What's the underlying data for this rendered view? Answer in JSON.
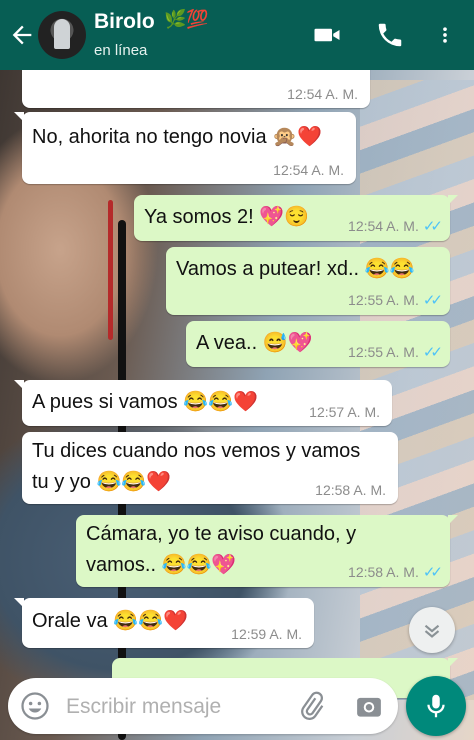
{
  "header": {
    "contact_name": "Birolo",
    "name_emoji": "🌿💯",
    "status": "en línea"
  },
  "messages": [
    {
      "dir": "in",
      "text": "",
      "time": "12:54 A. M."
    },
    {
      "dir": "in",
      "text": "No, ahorita no tengo novia 🙊❤️",
      "time": "12:54 A. M."
    },
    {
      "dir": "out",
      "text": "Ya somos 2! 💖😌",
      "time": "12:54 A. M."
    },
    {
      "dir": "out",
      "text": "Vamos a putear! xd.. 😂😂",
      "time": "12:55 A. M."
    },
    {
      "dir": "out",
      "text": "A vea.. 😅💖",
      "time": "12:55 A. M."
    },
    {
      "dir": "in",
      "text": "A pues si vamos 😂😂❤️",
      "time": "12:57 A. M."
    },
    {
      "dir": "in",
      "text": "Tu dices cuando nos vemos y vamos tu y yo 😂😂❤️",
      "time": "12:58 A. M."
    },
    {
      "dir": "out",
      "text": "Cámara, yo te aviso cuando, y vamos.. 😂😂💖",
      "time": "12:58 A. M."
    },
    {
      "dir": "in",
      "text": "Orale va 😂😂❤️",
      "time": "12:59 A. M."
    },
    {
      "dir": "out",
      "text": "",
      "time": ""
    }
  ],
  "read_ticks": "✓✓",
  "composer": {
    "placeholder": "Escribir mensaje"
  },
  "colors": {
    "header": "#075e54",
    "outgoing_bubble": "#dcf8c6",
    "incoming_bubble": "#ffffff",
    "read_ticks": "#4fc3f7",
    "mic_button": "#00897b"
  },
  "icons": [
    "back-arrow-icon",
    "video-call-icon",
    "phone-icon",
    "more-vert-icon",
    "chevron-down-icon",
    "emoji-icon",
    "attach-icon",
    "camera-icon",
    "mic-icon"
  ]
}
